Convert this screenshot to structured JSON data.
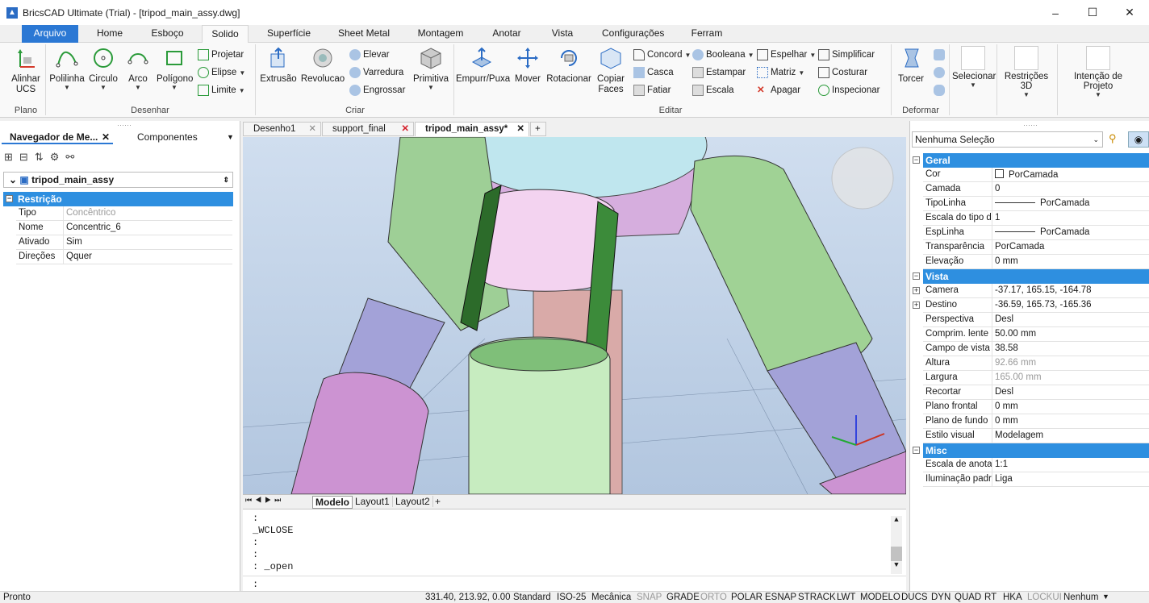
{
  "window": {
    "title": "BricsCAD Ultimate (Trial) - [tripod_main_assy.dwg]",
    "minimize": "–",
    "maximize": "☐",
    "close": "✕"
  },
  "ribbon_tabs": [
    "Arquivo",
    "Home",
    "Esboço",
    "Solido",
    "Superfície",
    "Sheet Metal",
    "Montagem",
    "Anotar",
    "Vista",
    "Configurações",
    "Ferram"
  ],
  "ribbon": {
    "plano": {
      "alinhar": "Alinhar\nUCS",
      "group": "Plano"
    },
    "desenhar": {
      "polilinha": "Polilinha",
      "circulo": "Circulo",
      "arco": "Arco",
      "poligono": "Polígono",
      "projetar": "Projetar",
      "elipse": "Elipse",
      "limite": "Limite",
      "group": "Desenhar"
    },
    "criar": {
      "extrusao": "Extrusão",
      "revolucao": "Revolucao",
      "elevar": "Elevar",
      "varredura": "Varredura",
      "engrossar": "Engrossar",
      "primitiva": "Primitiva",
      "group": "Criar"
    },
    "editar": {
      "empurr": "Empurr/Puxa",
      "mover": "Mover",
      "rotacionar": "Rotacionar",
      "copiar": "Copiar\nFaces",
      "concord": "Concord",
      "casca": "Casca",
      "fatiar": "Fatiar",
      "booleana": "Booleana",
      "estampar": "Estampar",
      "escala": "Escala",
      "espelhar": "Espelhar",
      "matriz": "Matriz",
      "apagar": "Apagar",
      "simplificar": "Simplificar",
      "costurar": "Costurar",
      "inspecionar": "Inspecionar",
      "group": "Editar"
    },
    "deformar": {
      "torcer": "Torcer",
      "group": "Deformar"
    },
    "selecionar": "Selecionar",
    "restricoes": "Restrições 3D",
    "intencao": "Intenção de Projeto"
  },
  "left_panel": {
    "tab1": "Navegador de Me...",
    "tab2": "Componentes",
    "tree_root": "tripod_main_assy",
    "section": "Restrição",
    "rows": [
      {
        "k": "Tipo",
        "v": "Concêntrico",
        "dim": true
      },
      {
        "k": "Nome",
        "v": "Concentric_6"
      },
      {
        "k": "Ativado",
        "v": "Sim"
      },
      {
        "k": "Direções",
        "v": "Qquer"
      }
    ]
  },
  "doc_tabs": [
    "Desenho1",
    "support_final",
    "tripod_main_assy*"
  ],
  "layout_tabs": [
    "Modelo",
    "Layout1",
    "Layout2"
  ],
  "command": {
    "lines": [
      ":",
      "_WCLOSE",
      ":",
      ":",
      ": _open"
    ],
    "prompt": ":"
  },
  "right_panel": {
    "selection": "Nenhuma Seleção",
    "geral": "Geral",
    "vista": "Vista",
    "misc": "Misc",
    "geral_rows": [
      {
        "k": "Cor",
        "v": "PorCamada"
      },
      {
        "k": "Camada",
        "v": "0"
      },
      {
        "k": "TipoLinha",
        "v": "PorCamada"
      },
      {
        "k": "Escala do tipo de",
        "v": "1"
      },
      {
        "k": "EspLinha",
        "v": "PorCamada"
      },
      {
        "k": "Transparência",
        "v": "PorCamada"
      },
      {
        "k": "Elevação",
        "v": "0 mm"
      }
    ],
    "vista_rows": [
      {
        "k": "Camera",
        "v": "-37.17, 165.15, -164.78"
      },
      {
        "k": "Destino",
        "v": "-36.59, 165.73, -165.36"
      },
      {
        "k": "Perspectiva",
        "v": "Desl"
      },
      {
        "k": "Comprim. lente",
        "v": "50.00 mm"
      },
      {
        "k": "Campo de vista",
        "v": "38.58"
      },
      {
        "k": "Altura",
        "v": "92.66 mm"
      },
      {
        "k": "Largura",
        "v": "165.00 mm"
      },
      {
        "k": "Recortar",
        "v": "Desl"
      },
      {
        "k": "Plano frontal",
        "v": "0 mm"
      },
      {
        "k": "Plano de fundo",
        "v": "0 mm"
      },
      {
        "k": "Estilo visual",
        "v": "Modelagem"
      }
    ],
    "misc_rows": [
      {
        "k": "Escala de anotaç",
        "v": "1:1"
      },
      {
        "k": "Iluminação padrã",
        "v": "Liga"
      }
    ]
  },
  "status": {
    "ready": "Pronto",
    "coords": "331.40, 213.92, 0.00",
    "items": [
      "Standard",
      "ISO-25",
      "Mecânica",
      "SNAP",
      "GRADE",
      "ORTO",
      "POLAR",
      "ESNAP",
      "STRACK",
      "LWT",
      "MODELO",
      "DUCS",
      "DYN",
      "QUAD",
      "RT",
      "HKA",
      "LOCKUI",
      "Nenhum"
    ]
  },
  "colors": {
    "accent": "#2b78d4",
    "header": "#2e8fe0",
    "green_part": "#a9d9a0",
    "purple_part": "#a3a2d8",
    "pink_part": "#e2b8e0"
  }
}
